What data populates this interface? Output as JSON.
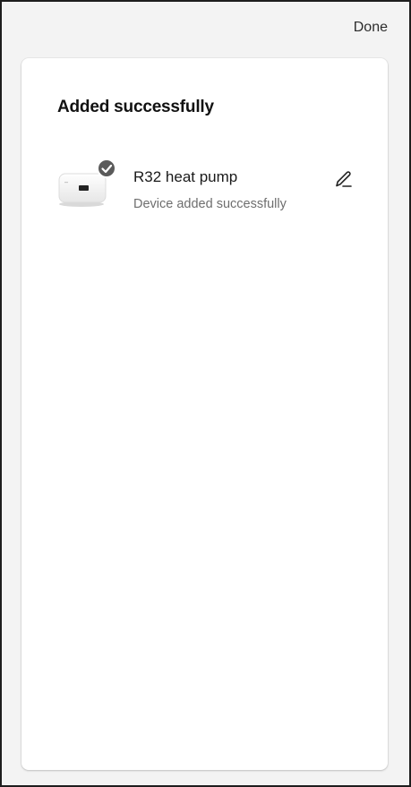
{
  "header": {
    "done_label": "Done"
  },
  "card": {
    "title": "Added successfully",
    "devices": [
      {
        "name": "R32 heat pump",
        "status": "Device added successfully",
        "icon": "heat-pump-device-icon",
        "badge_icon": "check-badge-icon",
        "action_icon": "pencil-edit-icon"
      }
    ]
  },
  "colors": {
    "background": "#f3f3f3",
    "card": "#ffffff",
    "title_text": "#111111",
    "secondary_text": "#6e6e6e",
    "badge": "#5a5a5a"
  }
}
